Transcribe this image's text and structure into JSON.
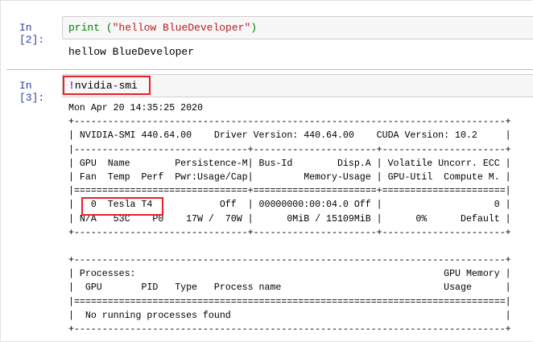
{
  "cells": [
    {
      "prompt": "In [2]:",
      "code": {
        "func": "print",
        "open": " (",
        "string": "\"hellow BlueDeveloper\"",
        "close": ")"
      },
      "output": "hellow BlueDeveloper"
    },
    {
      "prompt": "In [3]:",
      "code": {
        "bang": "!",
        "part1": "nvidia",
        "dash": "-",
        "part2": "smi"
      },
      "output_lines": [
        "Mon Apr 20 14:35:25 2020",
        "+-----------------------------------------------------------------------------+",
        "| NVIDIA-SMI 440.64.00    Driver Version: 440.64.00    CUDA Version: 10.2     |",
        "|-------------------------------+----------------------+----------------------+",
        "| GPU  Name        Persistence-M| Bus-Id        Disp.A | Volatile Uncorr. ECC |",
        "| Fan  Temp  Perf  Pwr:Usage/Cap|         Memory-Usage | GPU-Util  Compute M. |",
        "|===============================+======================+======================|",
        "|   0  Tesla T4            Off  | 00000000:00:04.0 Off |                    0 |",
        "| N/A   53C    P0    17W /  70W |      0MiB / 15109MiB |      0%      Default |",
        "+-------------------------------+----------------------+----------------------+",
        "",
        "+-----------------------------------------------------------------------------+",
        "| Processes:                                                       GPU Memory |",
        "|  GPU       PID   Type   Process name                             Usage      |",
        "|=============================================================================|",
        "|  No running processes found                                                 |",
        "+-----------------------------------------------------------------------------+"
      ]
    }
  ],
  "colors": {
    "highlight": "#e8202a",
    "prompt": "#303F9F"
  }
}
